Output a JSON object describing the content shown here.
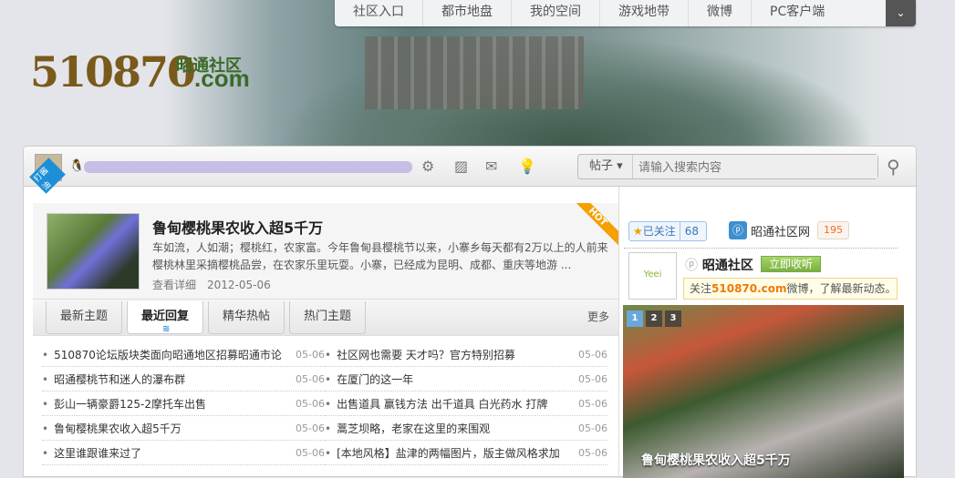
{
  "logo": {
    "number": "510870",
    "domain": ".com",
    "cn": "昭通社区"
  },
  "topnav": [
    "社区入口",
    "都市地盘",
    "我的空间",
    "游戏地带",
    "微博",
    "PC客户端"
  ],
  "toolbar": {
    "avatar_badge": "打酱油",
    "search_type": "帖子",
    "search_placeholder": "请输入搜索内容"
  },
  "featured": {
    "title": "鲁甸樱桃果农收入超5千万",
    "summary": "车如流，人如潮；樱桃红，农家富。今年鲁甸县樱桃节以来，小寨乡每天都有2万以上的人前来樱桃林里采摘樱桃品尝，在农家乐里玩耍。小寨，已经成为昆明、成都、重庆等地游 ...",
    "more": "查看详细",
    "date": "2012-05-06",
    "badge": "HOT"
  },
  "tabs": [
    "最新主题",
    "最近回复",
    "精华热帖",
    "热门主题"
  ],
  "more": "更多",
  "threads_left": [
    {
      "title": "510870论坛版块类面向昭通地区招募昭通市论",
      "date": "05-06"
    },
    {
      "title": "昭通樱桃节和迷人的瀑布群",
      "date": "05-06"
    },
    {
      "title": "彭山一辆豪爵125-2摩托车出售",
      "date": "05-06"
    },
    {
      "title": "鲁甸樱桃果农收入超5千万",
      "date": "05-06"
    },
    {
      "title": "这里谁跟谁来过了",
      "date": "05-06"
    }
  ],
  "threads_right": [
    {
      "title": "社区网也需要 天才吗？官方特别招募",
      "date": "05-06"
    },
    {
      "title": "在厦门的这一年",
      "date": "05-06"
    },
    {
      "title": "出售道具 赢钱方法 出千道具 白光药水 打牌",
      "date": "05-06"
    },
    {
      "title": "蒿芝坝略，老家在这里的来围观",
      "date": "05-06"
    },
    {
      "title": "[本地风格】盐津的两幅图片，版主做风格求加",
      "date": "05-06"
    }
  ],
  "weibo": {
    "followed": "已关注",
    "follow_count": "68",
    "site": "昭通社区网",
    "site_count": "195",
    "logo_text": "Yeei",
    "name": "昭通社区",
    "listen": "立即收听",
    "notice_pre": "关注",
    "notice_link": "510870.com",
    "notice_post": "微博，了解最新动态。"
  },
  "slider": {
    "pages": [
      "1",
      "2",
      "3"
    ],
    "caption": "鲁甸樱桃果农收入超5千万"
  }
}
